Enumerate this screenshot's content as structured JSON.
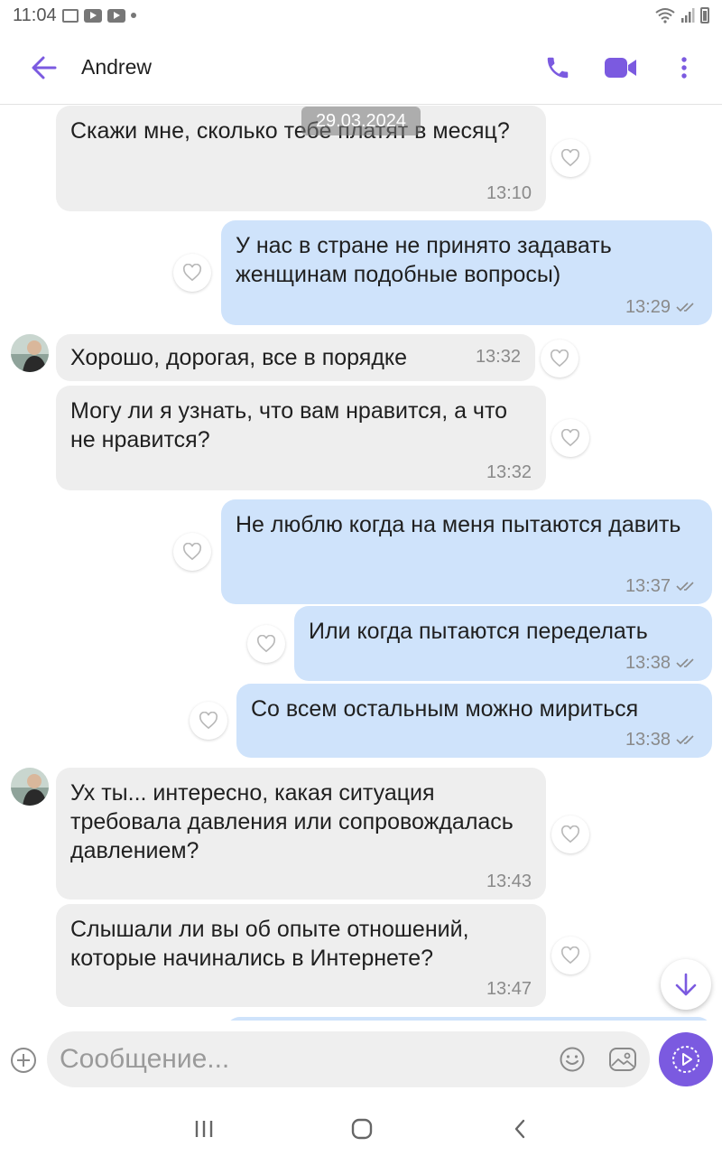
{
  "status_bar": {
    "time": "11:04"
  },
  "header": {
    "contact_name": "Andrew"
  },
  "chat": {
    "date": "29.03.2024",
    "messages": [
      {
        "direction": "incoming",
        "text": "Скажи мне, сколько тебе платят в месяц?",
        "time": "13:10"
      },
      {
        "direction": "outgoing",
        "text": "У нас в стране не принято задавать женщинам подобные вопросы)",
        "time": "13:29"
      },
      {
        "direction": "incoming",
        "text": "Хорошо, дорогая, все в порядке",
        "time": "13:32"
      },
      {
        "direction": "incoming",
        "text": "Могу ли я узнать, что вам нравится, а что не нравится?",
        "time": "13:32"
      },
      {
        "direction": "outgoing",
        "text": "Не люблю когда на меня пытаются давить",
        "time": "13:37"
      },
      {
        "direction": "outgoing",
        "text": "Или когда пытаются переделать",
        "time": "13:38"
      },
      {
        "direction": "outgoing",
        "text": "Со всем остальным можно мириться",
        "time": "13:38"
      },
      {
        "direction": "incoming",
        "text": "Ух ты... интересно, какая ситуация требовала давления или сопровождалась давлением?",
        "time": "13:43"
      },
      {
        "direction": "incoming",
        "text": "Слышали ли вы об опыте отношений, которые начинались в Интернете?",
        "time": "13:47"
      }
    ]
  },
  "composer": {
    "placeholder": "Сообщение..."
  },
  "icons": {
    "back": "arrow-left-icon",
    "call": "phone-icon",
    "video": "video-camera-icon",
    "menu": "more-vertical-icon",
    "like": "heart-outline-icon",
    "delivered": "double-check-icon",
    "scroll_down": "arrow-down-icon",
    "add": "plus-circle-icon",
    "sticker": "smiley-icon",
    "gallery": "image-icon",
    "send": "send-icon"
  },
  "colors": {
    "accent": "#7b5ae0",
    "incoming_bubble": "#eeeeee",
    "outgoing_bubble": "#cfe3fb"
  }
}
